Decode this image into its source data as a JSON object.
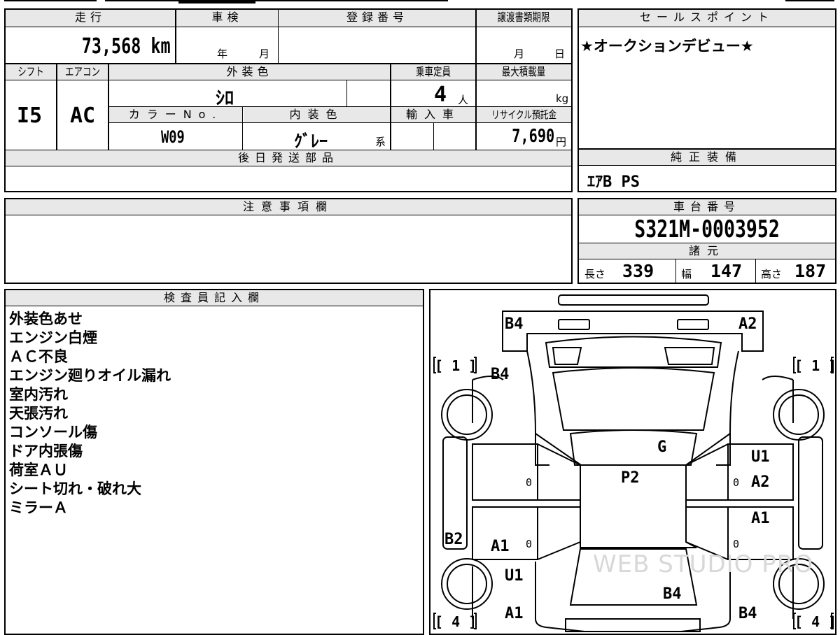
{
  "main_table": {
    "headers": {
      "mileage": "走行",
      "inspection": "車検",
      "registration": "登録番号",
      "transfer_deadline": "譲渡書類期限",
      "shift": "シフト",
      "ac": "エアコン",
      "exterior_color": "外装色",
      "capacity": "乗車定員",
      "max_load": "最大積載量",
      "color_no": "カラーNo.",
      "interior_color": "内装色",
      "import": "輸入車",
      "recycle_fee": "リサイクル預託金",
      "later_parts": "後日発送部品"
    },
    "mileage_value": "73,568",
    "mileage_unit": "km",
    "inspection_year_unit": "年",
    "inspection_month_unit": "月",
    "transfer_month_unit": "月",
    "transfer_day_unit": "日",
    "shift_value": "I5",
    "ac_value": "AC",
    "exterior_color_value": "ｼﾛ",
    "capacity_value": "4",
    "capacity_unit": "人",
    "max_load_unit": "kg",
    "color_no_value": "W09",
    "interior_color_value": "ｸﾞﾚｰ",
    "interior_color_suffix": "系",
    "recycle_fee_value": "7,690",
    "recycle_fee_unit": "円"
  },
  "sales_point": {
    "header": "セールスポイント",
    "text": "★オークションデビュー★"
  },
  "genuine_equipment": {
    "header": "純正装備",
    "text": "ｴｱB PS"
  },
  "notes": {
    "header": "注意事項欄"
  },
  "chassis": {
    "header": "車台番号",
    "value": "S321M-0003952",
    "specs_header": "諸元",
    "length_label": "長さ",
    "length_value": "339",
    "width_label": "幅",
    "width_value": "147",
    "height_label": "高さ",
    "height_value": "187"
  },
  "inspector": {
    "header": "検査員記入欄",
    "lines": [
      "外装色あせ",
      "エンジン白煙",
      "ＡＣ不良",
      "エンジン廻りオイル漏れ",
      "室内汚れ",
      "天張汚れ",
      "コンソール傷",
      "ドア内張傷",
      "荷室ＡＵ",
      "シート切れ・破れ大",
      "ミラーＡ"
    ]
  },
  "diagram": {
    "labels": {
      "front_left": "B4",
      "front_right": "A2",
      "hood_left": "B4",
      "windshield": "G",
      "roof": "P2",
      "right_front_door_1": "U1",
      "right_front_door_2": "A2",
      "right_rear_door": "A1",
      "left_rear_quarter": "B2",
      "left_rear_door": "A1",
      "left_rear_wheel": "U1",
      "rear_left": "A1",
      "rear_center": "B4",
      "rear_right": "B4"
    },
    "tire_marks": {
      "front_left": "[ 1 ]",
      "front_right": "[ 1 ]",
      "rear_left": "[ 4 ]",
      "rear_right": "[ 4 ]"
    },
    "zero": "0",
    "watermark": "WEB STUDIO PRO"
  }
}
